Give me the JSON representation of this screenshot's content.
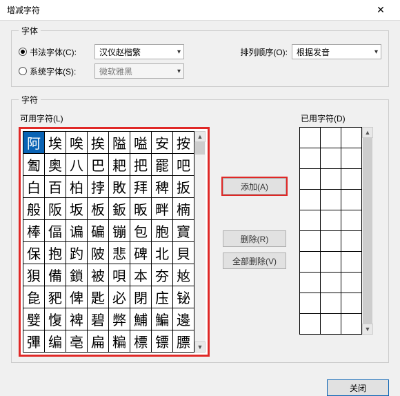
{
  "window": {
    "title": "增减字符"
  },
  "font_group": {
    "legend": "字体",
    "calligraphy_radio": "书法字体(C):",
    "system_radio": "系统字体(S):",
    "calligraphy_select": "汉仪赵楷繁",
    "system_select": "微软雅黑",
    "sort_label": "排列顺序(O):",
    "sort_select": "根据发音"
  },
  "char_group": {
    "legend": "字符",
    "avail_label": "可用字符(L)",
    "used_label": "已用字符(D)"
  },
  "buttons": {
    "add": "添加(A)",
    "remove": "删除(R)",
    "remove_all": "全部删除(V)",
    "close": "关闭"
  },
  "available_chars": [
    [
      "阿",
      "埃",
      "唉",
      "挨",
      "隘",
      "嗌",
      "安",
      "按"
    ],
    [
      "㔩",
      "奥",
      "八",
      "巴",
      "耙",
      "把",
      "罷",
      "吧"
    ],
    [
      "白",
      "百",
      "柏",
      "挬",
      "敗",
      "拜",
      "稗",
      "扳"
    ],
    [
      "般",
      "阪",
      "坂",
      "板",
      "鈑",
      "昄",
      "畔",
      "楠"
    ],
    [
      "棒",
      "偪",
      "谝",
      "碥",
      "镚",
      "包",
      "胞",
      "寶"
    ],
    [
      "保",
      "抱",
      "趵",
      "陂",
      "悲",
      "碑",
      "北",
      "貝"
    ],
    [
      "狽",
      "備",
      "鎖",
      "被",
      "唄",
      "本",
      "夯",
      "奿"
    ],
    [
      "㲋",
      "豝",
      "俾",
      "匙",
      "必",
      "閉",
      "庒",
      "铋"
    ],
    [
      "嬖",
      "愎",
      "裨",
      "碧",
      "弊",
      "鯆",
      "鯿",
      "邊"
    ],
    [
      "彃",
      "编",
      "亳",
      "扁",
      "糄",
      "標",
      "镖",
      "膘"
    ]
  ]
}
